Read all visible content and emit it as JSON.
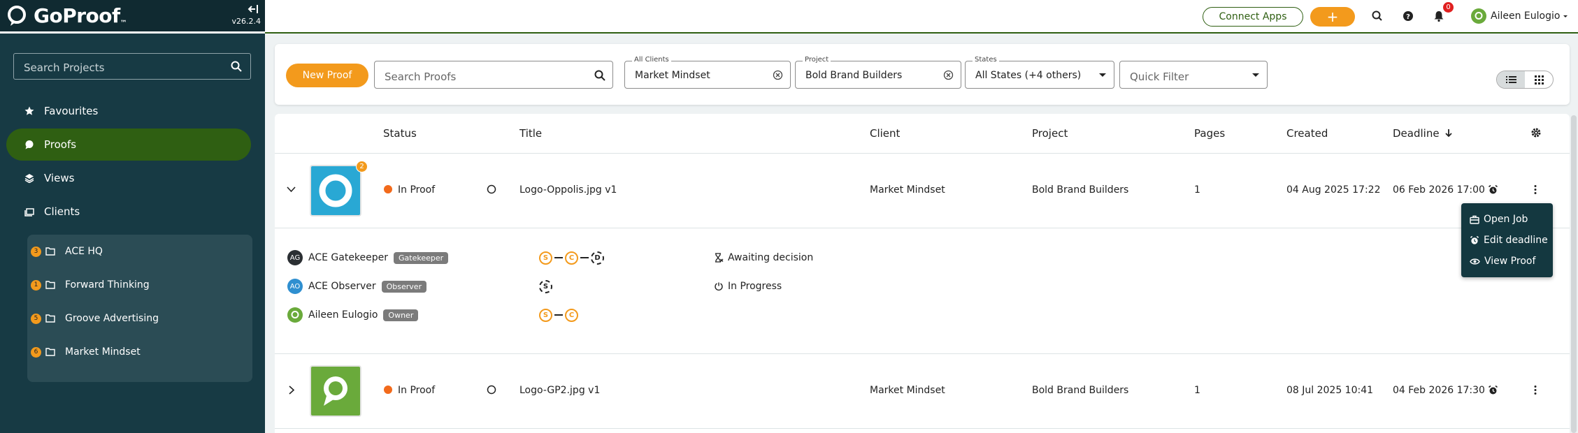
{
  "app": {
    "name": "GoProof",
    "trademark": "™",
    "version": "v26.2.4"
  },
  "sidebar": {
    "search_placeholder": "Search Projects",
    "nav": [
      {
        "label": "Favourites",
        "icon": "star-icon"
      },
      {
        "label": "Proofs",
        "icon": "chat-bubble-icon",
        "active": true
      },
      {
        "label": "Views",
        "icon": "layers-icon"
      },
      {
        "label": "Clients",
        "icon": "folders-icon"
      }
    ],
    "clients": [
      {
        "count": "3",
        "label": "ACE HQ"
      },
      {
        "count": "1",
        "label": "Forward Thinking"
      },
      {
        "count": "5",
        "label": "Groove Advertising"
      },
      {
        "count": "6",
        "label": "Market Mindset"
      }
    ]
  },
  "topbar": {
    "connect_label": "Connect Apps",
    "plus_label": "+",
    "notification_count": "0",
    "user_name": "Aileen Eulogio"
  },
  "filters": {
    "new_proof_label": "New Proof",
    "search_placeholder": "Search Proofs",
    "clients_label": "All Clients",
    "clients_value": "Market Mindset",
    "project_label": "Project",
    "project_value": "Bold Brand Builders",
    "states_label": "States",
    "states_value": "All States (+4 others)",
    "quick_filter_placeholder": "Quick Filter"
  },
  "table": {
    "columns": {
      "status": "Status",
      "title": "Title",
      "client": "Client",
      "project": "Project",
      "pages": "Pages",
      "created": "Created",
      "deadline": "Deadline"
    },
    "rows": [
      {
        "status": "In Proof",
        "title": "Logo-Oppolis.jpg  v1",
        "version_badge": "2",
        "client": "Market Mindset",
        "project": "Bold Brand Builders",
        "pages": "1",
        "created": "04 Aug 2025 17:22",
        "deadline": "06 Feb 2026 17:00",
        "thumb_color": "#29a8d4"
      },
      {
        "status": "In Proof",
        "title": "Logo-GP2.jpg  v1",
        "client": "Market Mindset",
        "project": "Bold Brand Builders",
        "pages": "1",
        "created": "08 Jul 2025 10:41",
        "deadline": "04 Feb 2026 17:30",
        "thumb_color": "#6aaa3b"
      }
    ],
    "participants": [
      {
        "initials": "AG",
        "name": "ACE Gatekeeper",
        "role": "Gatekeeper",
        "avatar_color": "#2b2f33",
        "steps": [
          "S",
          "C",
          "D"
        ],
        "status": "Awaiting decision"
      },
      {
        "initials": "AO",
        "name": "ACE Observer",
        "role": "Observer",
        "avatar_color": "#2f8fd0",
        "steps": [
          "S"
        ],
        "status": "In Progress"
      },
      {
        "initials": "",
        "name": "Aileen Eulogio",
        "role": "Owner",
        "avatar_color": "#6aaa3b",
        "steps": [
          "S",
          "C"
        ],
        "status": ""
      }
    ]
  },
  "context_menu": {
    "items": [
      {
        "label": "Open Job",
        "icon": "briefcase-icon"
      },
      {
        "label": "Edit deadline",
        "icon": "alarm-clock-icon"
      },
      {
        "label": "View Proof",
        "icon": "eye-icon"
      }
    ]
  },
  "colors": {
    "sidebar_bg": "#173a44",
    "accent_orange": "#f39a1c",
    "active_green": "#2f5f12",
    "status_orange": "#f26a1b"
  }
}
